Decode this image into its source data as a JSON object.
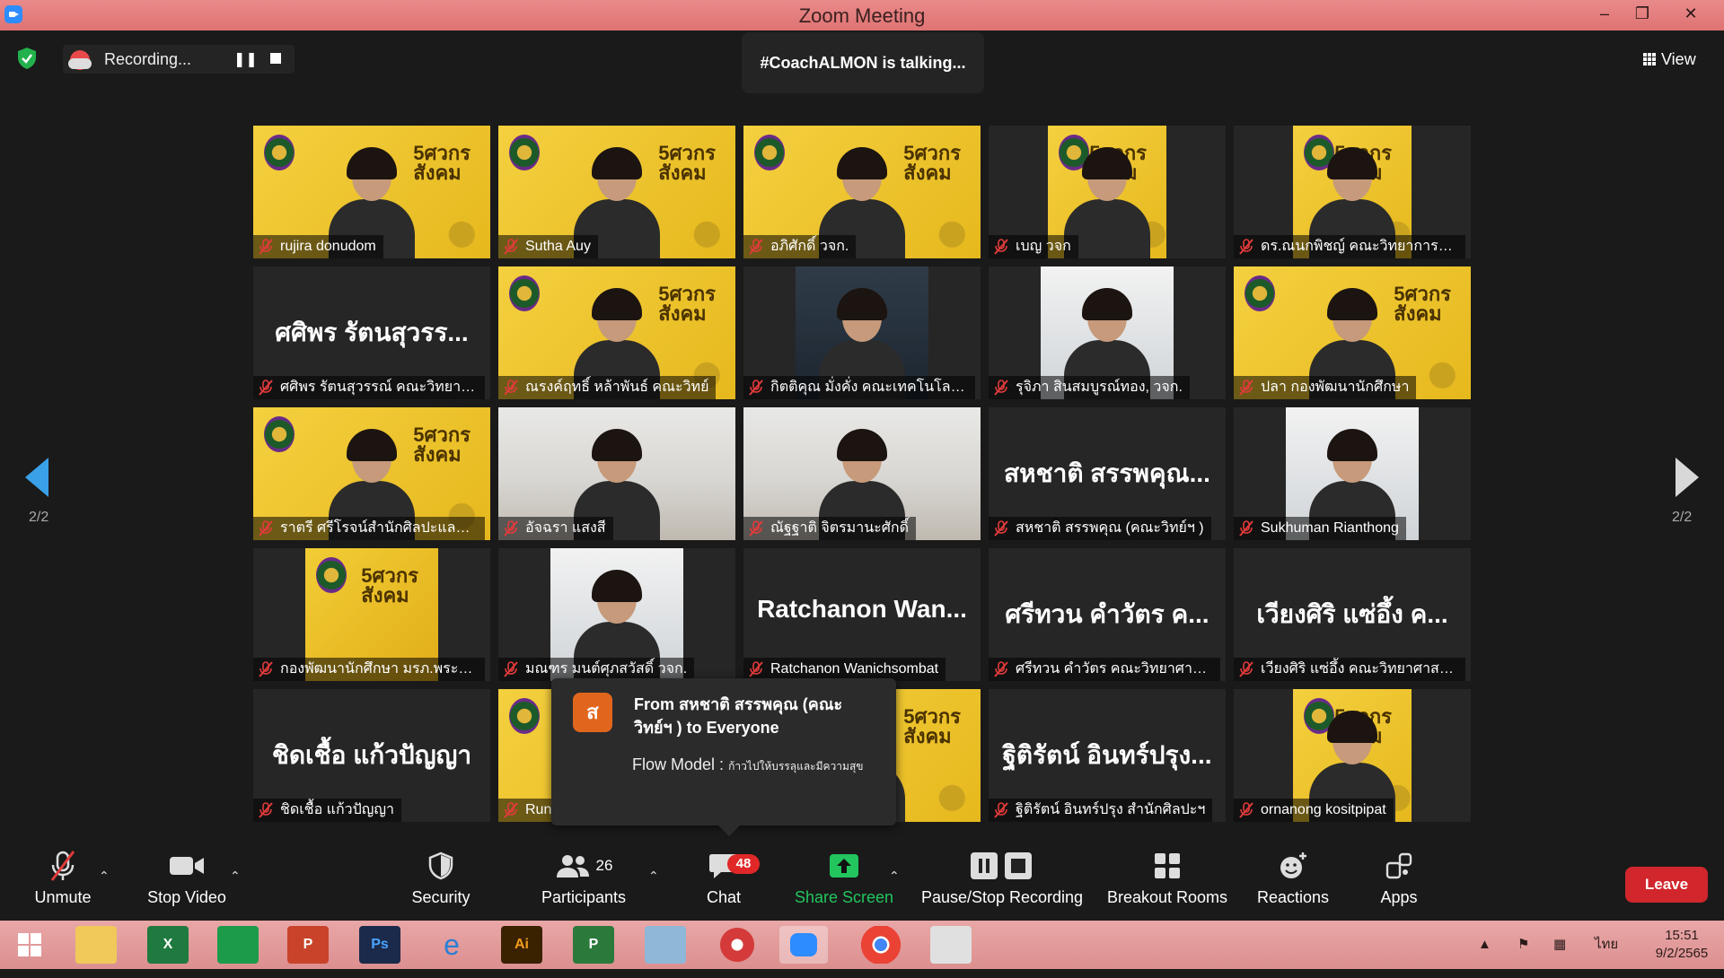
{
  "window": {
    "title": "Zoom Meeting"
  },
  "recording": {
    "label": "Recording..."
  },
  "speaker": {
    "text": "#CoachALMON is talking..."
  },
  "view_button": {
    "label": "View"
  },
  "pagination": {
    "left": "2/2",
    "right": "2/2"
  },
  "tiles": [
    {
      "name": "rujira donudom",
      "type": "yellow",
      "big": ""
    },
    {
      "name": "Sutha Auy",
      "type": "yellow",
      "big": ""
    },
    {
      "name": "อภิศักดิ์ วจก.",
      "type": "yellow",
      "big": ""
    },
    {
      "name": "เบญ วจก",
      "type": "yellow-narrow",
      "big": ""
    },
    {
      "name": "ดร.ณนกพิชญ์ คณะวิทยาการจัด...",
      "type": "yellow-narrow",
      "big": ""
    },
    {
      "name": "ศศิพร รัตนสุวรรณ์ คณะวิทยาศ...",
      "type": "blank",
      "big": "ศศิพร รัตนสุวรร..."
    },
    {
      "name": "ณรงค์ฤทธิ์ หล้าพันธ์ คณะวิทย์",
      "type": "yellow",
      "big": ""
    },
    {
      "name": "กิตติคุณ มั่งคั่ง คณะเทคโนโลยีอุ...",
      "type": "dark",
      "big": ""
    },
    {
      "name": "รุจิภา สินสมบูรณ์ทอง, วจก.",
      "type": "light",
      "big": ""
    },
    {
      "name": "ปลา กองพัฒนานักศึกษา",
      "type": "yellow",
      "big": ""
    },
    {
      "name": "ราตรี ศรีโรจน์สำนักศิลปะและว...",
      "type": "yellow",
      "big": ""
    },
    {
      "name": "อัจฉรา แสงสี",
      "type": "office",
      "big": ""
    },
    {
      "name": "ณัฐฐาติ จิตรมานะศักดิ์",
      "type": "office",
      "big": ""
    },
    {
      "name": "สหชาติ สรรพคุณ (คณะวิทย์ฯ )",
      "type": "blank",
      "big": "สหชาติ สรรพคุณ..."
    },
    {
      "name": "Sukhuman Rianthong",
      "type": "light",
      "big": ""
    },
    {
      "name": "กองพัฒนานักศึกษา มรภ.พระนคร",
      "type": "logo",
      "big": ""
    },
    {
      "name": "มณฑร มนต์ศุภสวัสดิ์ วจก.",
      "type": "light",
      "big": ""
    },
    {
      "name": "Ratchanon Wanichsombat",
      "type": "blank",
      "big": "Ratchanon Wan..."
    },
    {
      "name": "ศรีทวน คำวัตร คณะวิทยาศาส...",
      "type": "blank",
      "big": "ศรีทวน คำวัตร ค..."
    },
    {
      "name": "เวียงศิริ แซ่อึ้ง คณะวิทยาศาสต...",
      "type": "blank",
      "big": "เวียงศิริ แซ่อึ้ง ค..."
    },
    {
      "name": "ชิดเชื้อ แก้วปัญญา",
      "type": "blank",
      "big": "ชิดเชื้อ แก้วปัญญา"
    },
    {
      "name": "Run",
      "type": "yellow",
      "big": ""
    },
    {
      "name": "",
      "type": "yellow",
      "big": ""
    },
    {
      "name": "ฐิติรัตน์ อินทร์ปรุง สำนักศิลปะฯ",
      "type": "blank",
      "big": "ฐิติรัตน์ อินทร์ปรุง..."
    },
    {
      "name": "ornanong kositpipat",
      "type": "yellow-narrow",
      "big": ""
    }
  ],
  "banner_text": {
    "line1": "5ศวกร",
    "line2": "สังคม"
  },
  "chat_toast": {
    "avatar": "ส",
    "from": "From สหชาติ สรรพคุณ (คณะวิทย์ฯ ) to Everyone",
    "message": "Flow Model :",
    "message_small": "ก้าวไปให้บรรลุและมีความสุข"
  },
  "toolbar": {
    "unmute": "Unmute",
    "stop_video": "Stop Video",
    "security": "Security",
    "participants": "Participants",
    "participants_count": "26",
    "chat": "Chat",
    "chat_badge": "48",
    "share_screen": "Share Screen",
    "pause_stop_recording": "Pause/Stop Recording",
    "breakout_rooms": "Breakout Rooms",
    "reactions": "Reactions",
    "apps": "Apps",
    "leave": "Leave"
  },
  "taskbar": {
    "lang": "ไทย",
    "time": "15:51",
    "date": "9/2/2565",
    "apps": [
      "Windows",
      "File Explorer",
      "Excel",
      "Publisher",
      "PowerPoint",
      "Photoshop",
      "Internet Explorer",
      "Illustrator",
      "Project",
      "Notes",
      "PhotoScape",
      "Zoom",
      "Chrome",
      "Photos"
    ]
  },
  "colors": {
    "accent_blue": "#2d8cff",
    "leave_red": "#d0262c",
    "share_green": "#22c55e",
    "titlebar": "#df7373",
    "tile_bg": "#262626"
  }
}
